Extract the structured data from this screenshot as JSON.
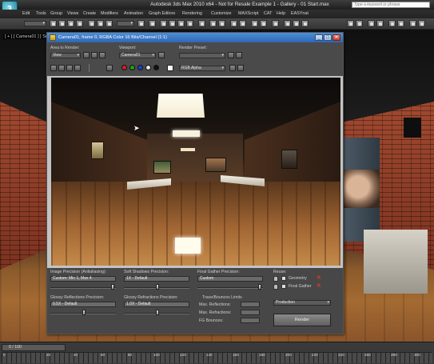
{
  "app": {
    "logo_text": "3",
    "window_title": "Autodesk 3ds Max  2010 x64    - Not for Resale    Example 1 - Gallery - 01 Start.max",
    "search_placeholder": "Type a keyword or phrase"
  },
  "menu": [
    "Edit",
    "Tools",
    "Group",
    "Views",
    "Create",
    "Modifiers",
    "Animation",
    "Graph Editors",
    "Rendering",
    "Customize",
    "MAXScript",
    "CAT",
    "Help",
    "EASYnat"
  ],
  "viewport": {
    "label": "[ + ] [ Camera01 ] [ Sm"
  },
  "frame_buffer": {
    "title": "Camera01, frame 0, RGBA Color 16 Bits/Channel (1:1)",
    "area_to_render_label": "Area to Render:",
    "area_to_render_value": "View",
    "viewport_label": "Viewport:",
    "viewport_value": "Camera01",
    "render_preset_label": "Render Preset:",
    "render_preset_value": "",
    "channel_value": "RGB Alpha",
    "settings": {
      "image_precision_label": "Image Precision (Antialiasing):",
      "image_precision_value": "Custom: Min 1, Max 4",
      "soft_shadows_label": "Soft Shadows Precision:",
      "soft_shadows_value": "1X - Default",
      "final_gather_label": "Final Gather Precision:",
      "final_gather_value": "Custom",
      "reuse_label": "Reuse:",
      "geometry_label": "Geometry",
      "final_gather_check_label": "Final Gather",
      "glossy_reflections_label": "Glossy Reflections Precision:",
      "glossy_reflections_value": "0.5X - Default",
      "glossy_refractions_label": "Glossy Refractions Precision:",
      "glossy_refractions_value": "1.0X - Default",
      "trace_bounces_label": "Trace/Bounces Limits",
      "max_reflections_label": "Max. Reflections:",
      "max_reflections_value": "",
      "max_refractions_label": "Max. Refractions:",
      "max_refractions_value": "",
      "fg_bounces_label": "FG Bounces:",
      "fg_bounces_value": "",
      "production_value": "Production",
      "render_button": "Render"
    }
  },
  "timeline": {
    "slider_text": "0 / 100",
    "ticks": [
      "0",
      "20",
      "40",
      "60",
      "80",
      "100",
      "120",
      "140",
      "160",
      "180",
      "200",
      "220",
      "240",
      "260",
      "280",
      "300"
    ]
  },
  "colors": {
    "fb_title_blue": "#2f66b3",
    "close_red": "#c13f2a",
    "brick": "#8b3b25",
    "floor_wood": "#a46a32"
  }
}
